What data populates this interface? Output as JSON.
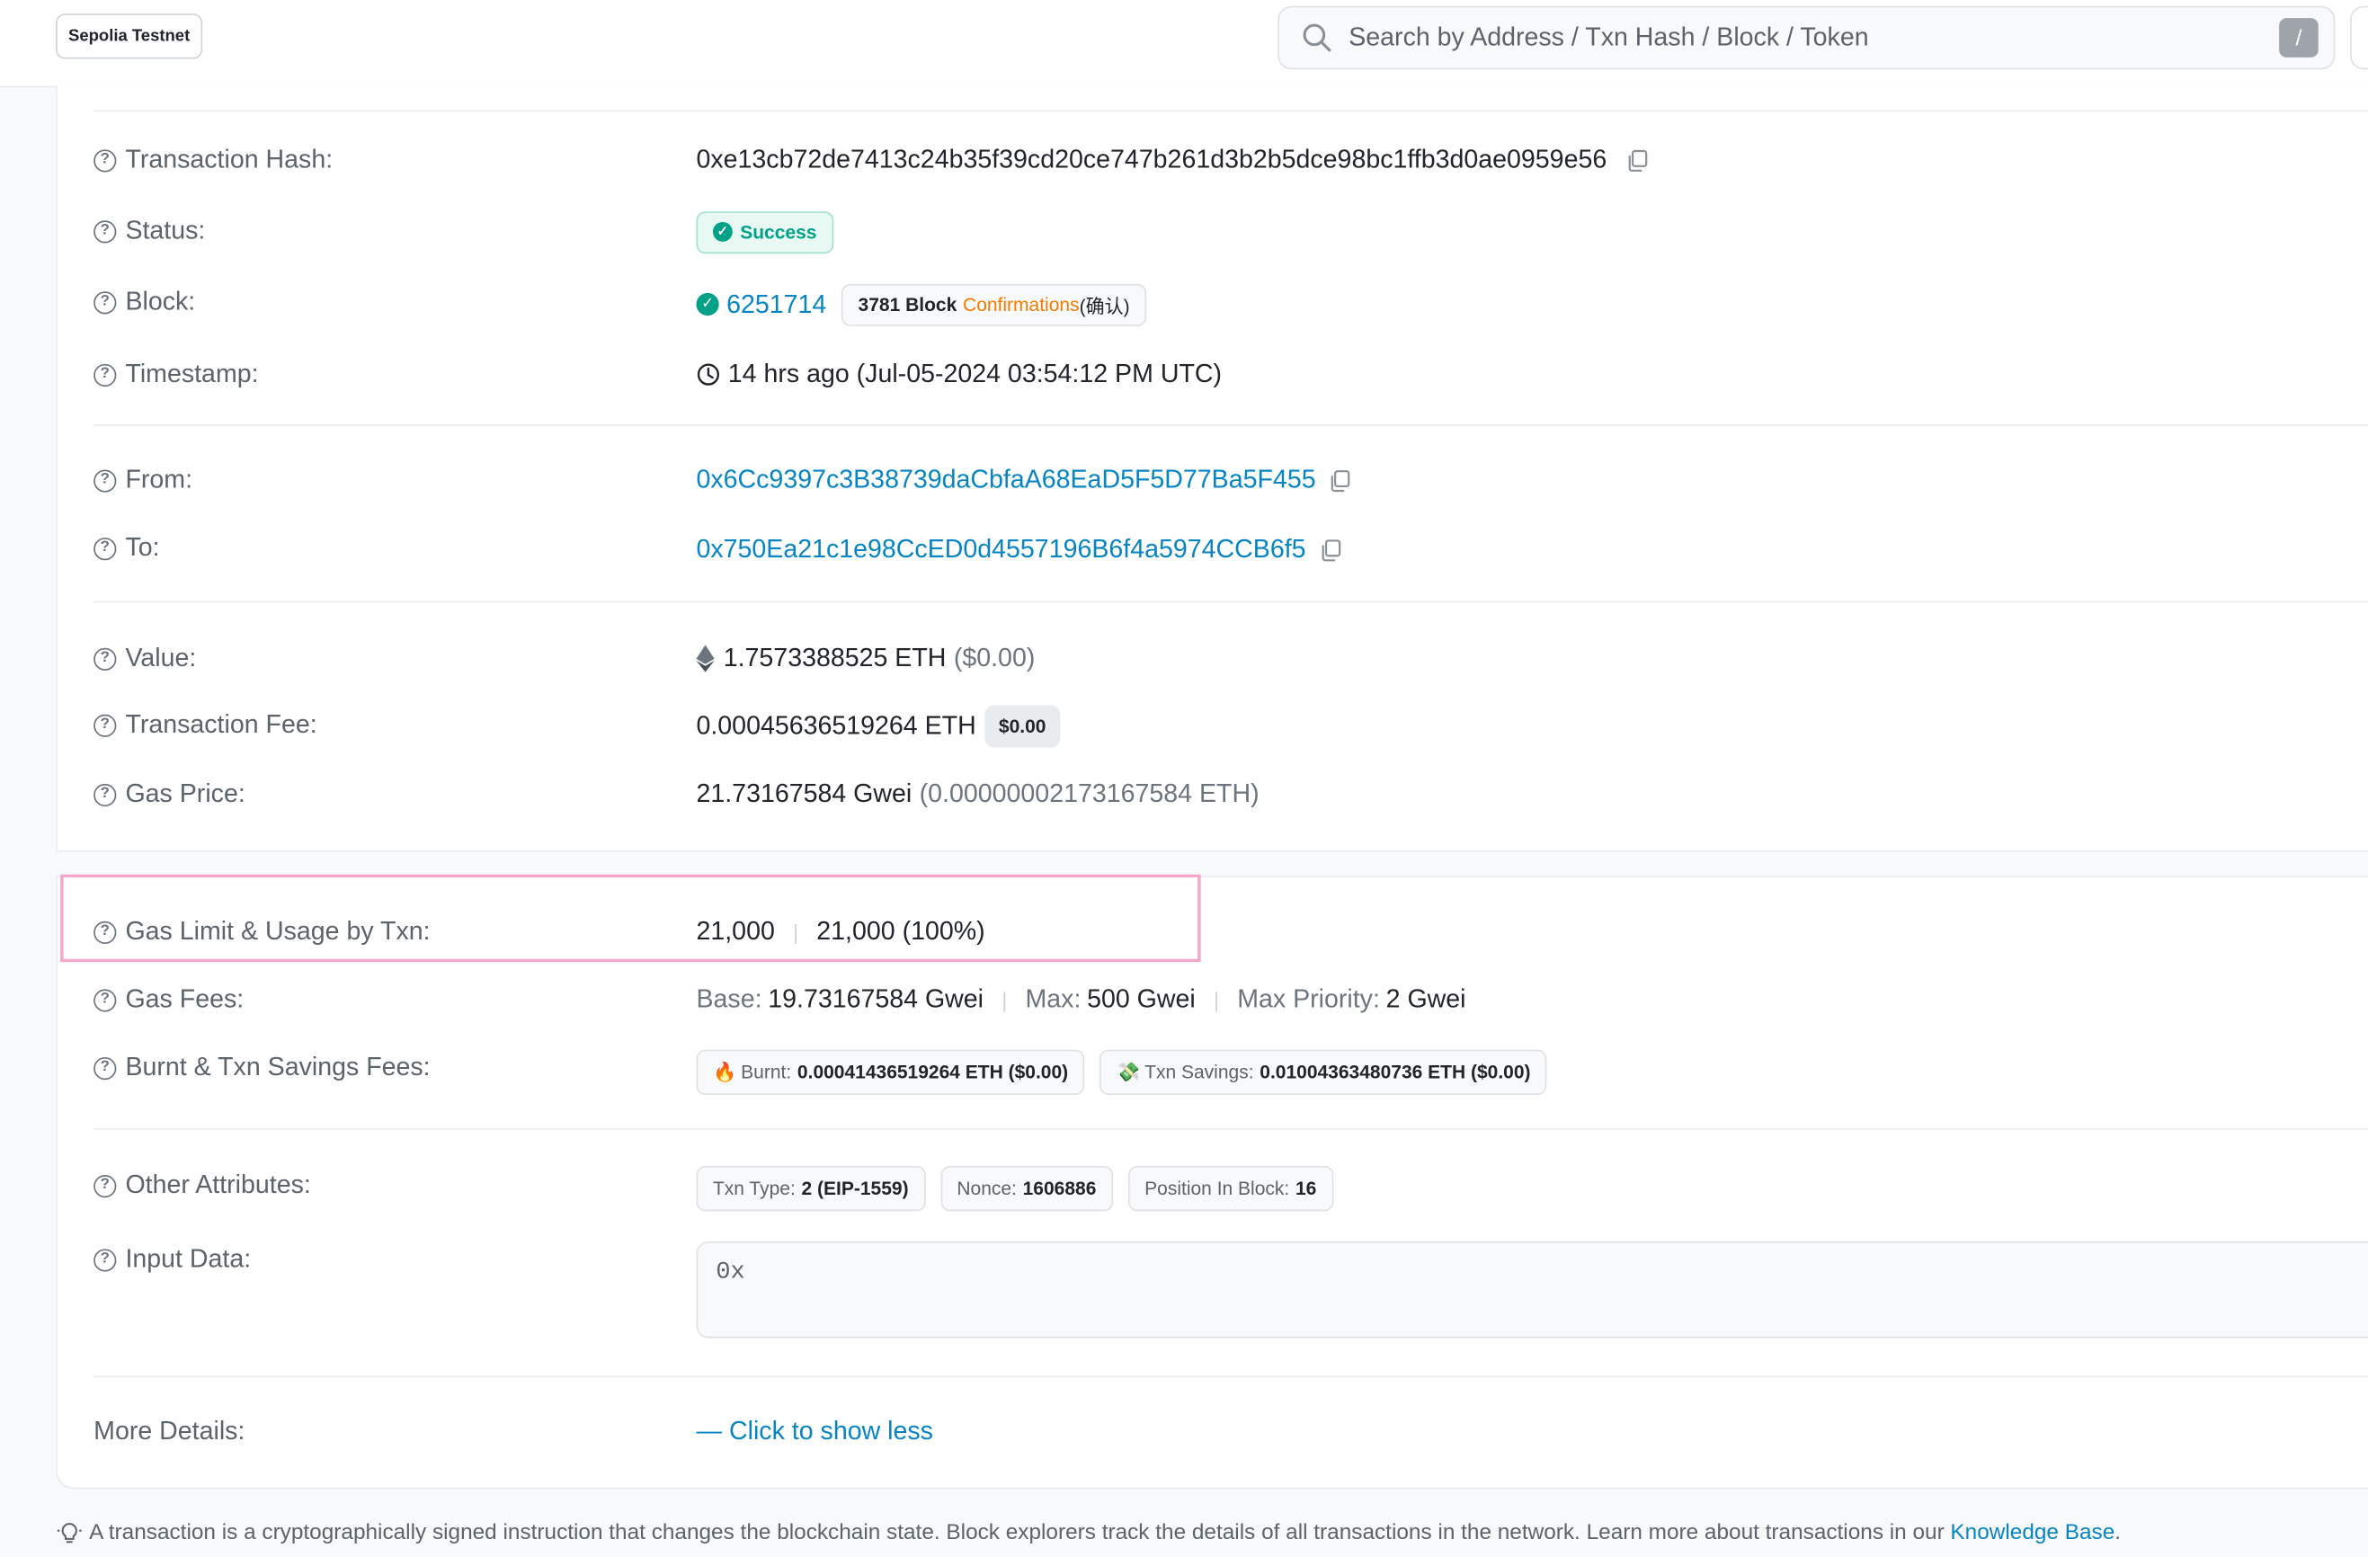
{
  "header": {
    "network_badge": "Sepolia Testnet",
    "search_placeholder": "Search by Address / Txn Hash / Block / Token",
    "search_shortcut": "/"
  },
  "overview": {
    "tx_hash": {
      "label": "Transaction Hash:",
      "value": "0xe13cb72de7413c24b35f39cd20ce747b261d3b2b5dce98bc1ffb3d0ae0959e56"
    },
    "status": {
      "label": "Status:",
      "value": "Success"
    },
    "block": {
      "label": "Block:",
      "value": "6251714",
      "confirmations_count": "3781 Block",
      "confirmations_word": "Confirmations",
      "confirmations_suffix": "(确认)"
    },
    "timestamp": {
      "label": "Timestamp:",
      "value": "14 hrs ago (Jul-05-2024 03:54:12 PM UTC)"
    },
    "from": {
      "label": "From:",
      "value": "0x6Cc9397c3B38739daCbfaA68EaD5F5D77Ba5F455"
    },
    "to": {
      "label": "To:",
      "value": "0x750Ea21c1e98CcED0d4557196B6f4a5974CCB6f5"
    },
    "value": {
      "label": "Value:",
      "amount": "1.7573388525 ETH",
      "usd": "($0.00)"
    },
    "tx_fee": {
      "label": "Transaction Fee:",
      "amount": "0.00045636519264 ETH",
      "usd": "$0.00"
    },
    "gas_price": {
      "label": "Gas Price:",
      "gwei": "21.73167584 Gwei",
      "eth": "(0.00000002173167584 ETH)"
    }
  },
  "more": {
    "gas_limit": {
      "label": "Gas Limit & Usage by Txn:",
      "limit": "21,000",
      "usage": "21,000 (100%)"
    },
    "gas_fees": {
      "label": "Gas Fees:",
      "base_label": "Base:",
      "base_value": "19.73167584 Gwei",
      "max_label": "Max:",
      "max_value": "500 Gwei",
      "priority_label": "Max Priority:",
      "priority_value": "2 Gwei"
    },
    "burnt_savings": {
      "label": "Burnt & Txn Savings Fees:",
      "burnt_label": "Burnt:",
      "burnt_value": "0.00041436519264 ETH ($0.00)",
      "savings_label": "Txn Savings:",
      "savings_value": "0.01004363480736 ETH ($0.00)"
    },
    "other_attributes": {
      "label": "Other Attributes:",
      "txn_type_label": "Txn Type:",
      "txn_type_value": "2 (EIP-1559)",
      "nonce_label": "Nonce:",
      "nonce_value": "1606886",
      "position_label": "Position In Block:",
      "position_value": "16"
    },
    "input_data": {
      "label": "Input Data:",
      "value": "0x"
    },
    "more_details": {
      "label": "More Details:",
      "link": "— Click to show less"
    }
  },
  "footer": {
    "note": "A transaction is a cryptographically signed instruction that changes the blockchain state. Block explorers track the details of all transactions in the network. Learn more about transactions in our",
    "link": "Knowledge Base",
    "end": "."
  },
  "colors": {
    "link": "#0784c3",
    "success": "#00a186",
    "highlight": "#f4a6cb",
    "orange": "#f47b00"
  },
  "icons": [
    "search-icon",
    "help-circle-icon",
    "copy-icon",
    "check-circle-icon",
    "clock-icon",
    "ethereum-icon",
    "fire-icon",
    "money-icon",
    "lightbulb-icon"
  ]
}
